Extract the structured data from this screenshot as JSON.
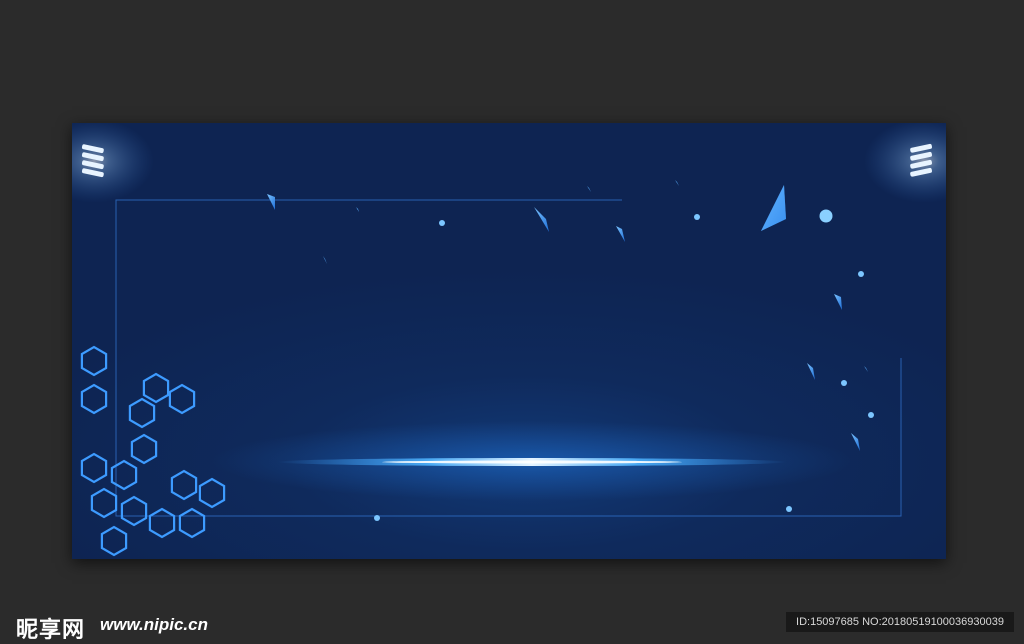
{
  "poster": {
    "background_color": "#0e2452",
    "glow_color": "#3aa0ff",
    "accent_color": "#4aa8ff",
    "decorations": [
      "stage-spotlight-left",
      "stage-spotlight-right",
      "frame-border",
      "light-beam",
      "hexagon-cluster",
      "crystal-shards",
      "light-dots"
    ]
  },
  "watermark": {
    "logo_text": "昵享网",
    "url_text": "www.nipic.cn",
    "id_text": "ID:15097685 NO:20180519100036930039",
    "cropped_line": "ID:15097685 NO:20180519100036930039"
  }
}
